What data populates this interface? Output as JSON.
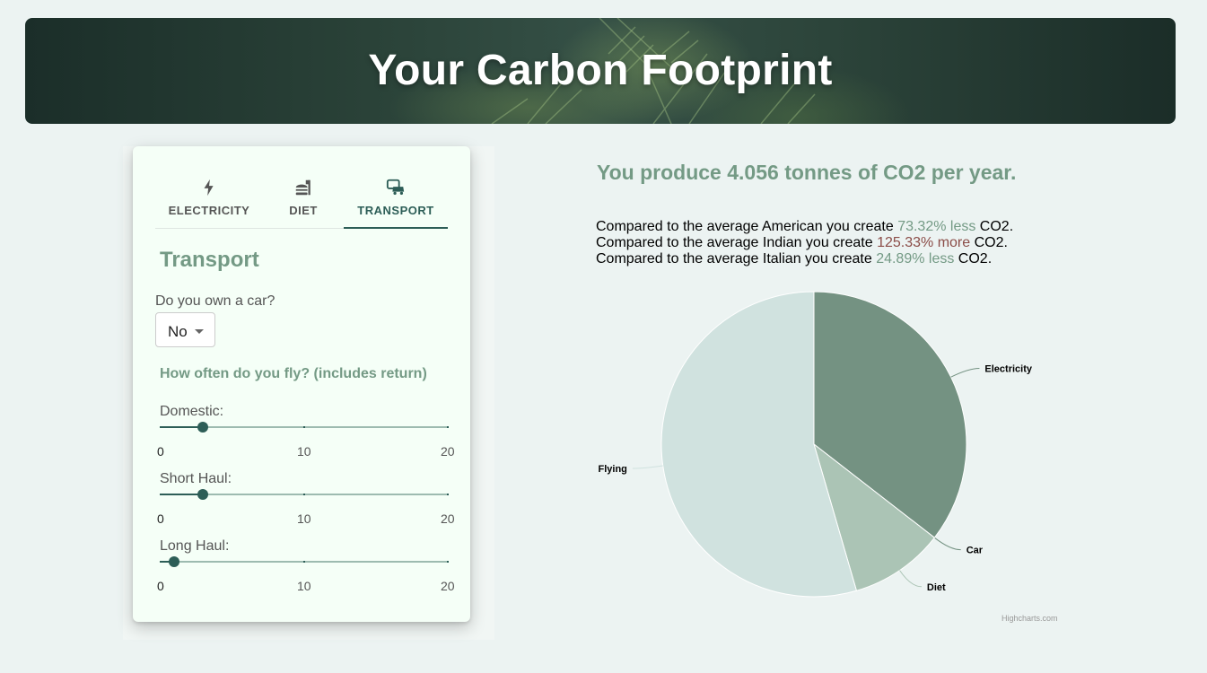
{
  "header": {
    "title": "Your Carbon Footprint"
  },
  "tabs": [
    {
      "label": "ELECTRICITY",
      "icon": "lightning-icon",
      "active": false
    },
    {
      "label": "DIET",
      "icon": "food-icon",
      "active": false
    },
    {
      "label": "TRANSPORT",
      "icon": "car-bus-icon",
      "active": true
    }
  ],
  "transport": {
    "section_title": "Transport",
    "car_question": "Do you own a car?",
    "car_value": "No",
    "fly_question": "How often do you fly? (includes return)",
    "sliders": [
      {
        "label": "Domestic:",
        "value": 3,
        "min": "0",
        "mid": "10",
        "max": "20"
      },
      {
        "label": "Short Haul:",
        "value": 3,
        "min": "0",
        "mid": "10",
        "max": "20"
      },
      {
        "label": "Long Haul:",
        "value": 1,
        "min": "0",
        "mid": "10",
        "max": "20"
      }
    ]
  },
  "results": {
    "headline": "You produce 4.056 tonnes of CO2 per year.",
    "comparisons": [
      {
        "prefix": "Compared to the average American you create ",
        "amount": "73.32% less",
        "kind": "less",
        "suffix": " CO2."
      },
      {
        "prefix": "Compared to the average Indian you create ",
        "amount": "125.33% more",
        "kind": "more",
        "suffix": " CO2."
      },
      {
        "prefix": "Compared to the average Italian you create ",
        "amount": "24.89% less",
        "kind": "less",
        "suffix": " CO2."
      }
    ],
    "credit": "Highcharts.com"
  },
  "colors": {
    "accent": "#749a85",
    "primary": "#2d5e57",
    "more": "#8b4d48"
  },
  "chart_data": {
    "type": "pie",
    "title": "",
    "categories": [
      "Electricity",
      "Car",
      "Diet",
      "Flying"
    ],
    "values": [
      35.5,
      0.0,
      10.0,
      54.5
    ],
    "unit": "percent (estimated)",
    "colors": [
      "#749282",
      "#749282",
      "#abc4b5",
      "#d0e2df"
    ]
  }
}
